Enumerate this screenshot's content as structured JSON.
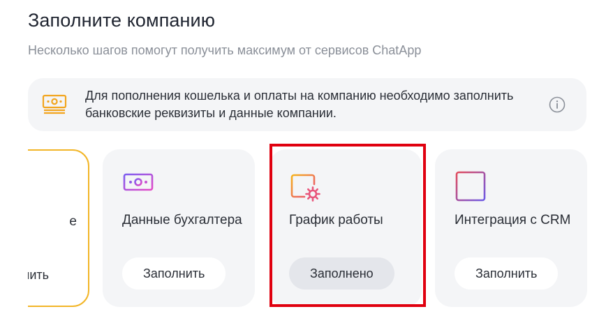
{
  "header": {
    "title": "Заполните компанию",
    "subtitle": "Несколько шагов помогут получить максимум от сервисов ChatApp"
  },
  "banner": {
    "text": "Для пополнения кошелька и оплаты на компанию необходимо заполнить банковские реквизиты и данные компании.",
    "icon": "money-icon",
    "info_icon": "info-icon"
  },
  "cards": [
    {
      "label": "е",
      "button": "нить",
      "state": "pending",
      "icon": ""
    },
    {
      "label": "Данные бухгалтера",
      "button": "Заполнить",
      "state": "pending",
      "icon": "money-icon"
    },
    {
      "label": "График работы",
      "button": "Заполнено",
      "state": "done",
      "icon": "calendar-gear-icon"
    },
    {
      "label": "Интеграция с CRM",
      "button": "Заполнить",
      "state": "pending",
      "icon": "table-icon"
    }
  ],
  "colors": {
    "accent_yellow": "#f2b526",
    "highlight_red": "#e0000f",
    "card_bg": "#f4f5f7"
  }
}
